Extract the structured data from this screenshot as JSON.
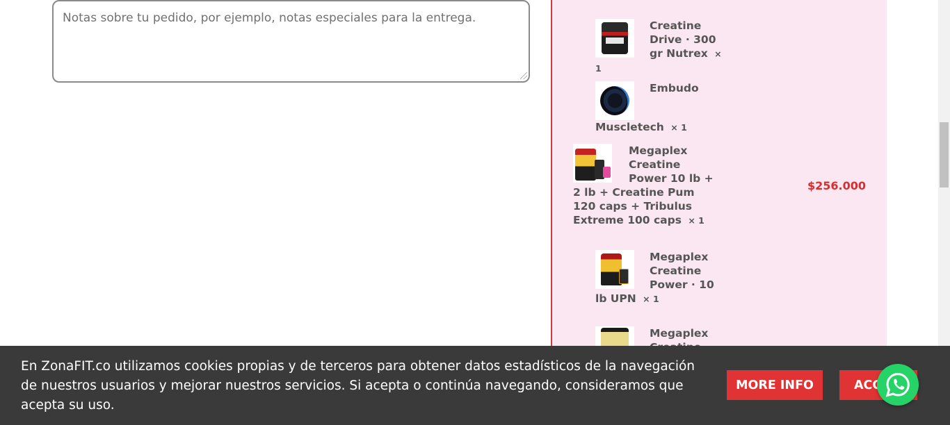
{
  "checkout": {
    "notes_placeholder": "Notas sobre tu pedido, por ejemplo, notas especiales para la entrega."
  },
  "order_summary": {
    "items": [
      {
        "name": "Creatine Drive · 300 gr Nutrex",
        "qty": "× 1",
        "thumb_icon": "creatine-tub-icon"
      },
      {
        "name": "Embudo Muscletech",
        "qty": "× 1",
        "thumb_icon": "funnel-icon"
      },
      {
        "name": "Megaplex Creatine Power 10 lb + 2 lb + Creatine Pum 120 caps + Tribulus Extreme 100 caps",
        "qty": "× 1",
        "price": "$256.000",
        "thumb_icon": "combo-pack-icon"
      },
      {
        "name": "Megaplex Creatine Power · 10 lb UPN",
        "qty": "× 1",
        "thumb_icon": "creatine-bag-icon"
      },
      {
        "name": "Megaplex Creatine",
        "qty": "",
        "thumb_icon": "supplement-pouch-icon"
      }
    ],
    "accent_color": "#d52f2f",
    "panel_color": "#fbe7f1"
  },
  "cookie_banner": {
    "text": "En ZonaFIT.co utilizamos cookies propias y de terceros para obtener datos estadísticos de la navegación de nuestros usuarios y mejorar nuestros servicios. Si acepta o continúa navegando, consideramos que acepta su uso.",
    "more_info_label": "MORE INFO",
    "accept_label": "ACCEPT",
    "button_color": "#e03434"
  },
  "whatsapp": {
    "icon": "whatsapp-icon",
    "color": "#25d366"
  }
}
